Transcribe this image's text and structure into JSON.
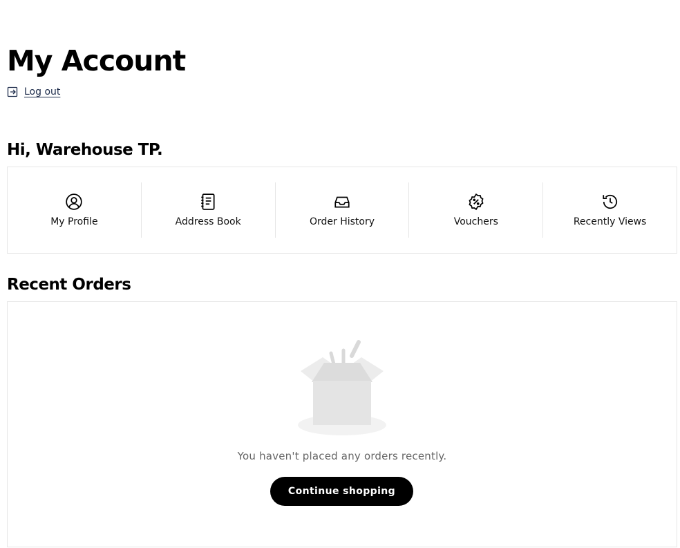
{
  "header": {
    "title": "My Account",
    "logout_label": "Log out",
    "logout_icon": "logout-icon"
  },
  "greeting": "Hi, Warehouse TP.",
  "account_nav": [
    {
      "label": "My Profile",
      "icon": "user-circle-icon"
    },
    {
      "label": "Address Book",
      "icon": "address-book-icon"
    },
    {
      "label": "Order History",
      "icon": "inbox-icon"
    },
    {
      "label": "Vouchers",
      "icon": "voucher-badge-icon"
    },
    {
      "label": "Recently Views",
      "icon": "history-clock-icon"
    }
  ],
  "recent_orders": {
    "title": "Recent Orders",
    "empty_message": "You haven't placed any orders recently.",
    "empty_illustration": "empty-box-icon",
    "cta_label": "Continue shopping"
  }
}
